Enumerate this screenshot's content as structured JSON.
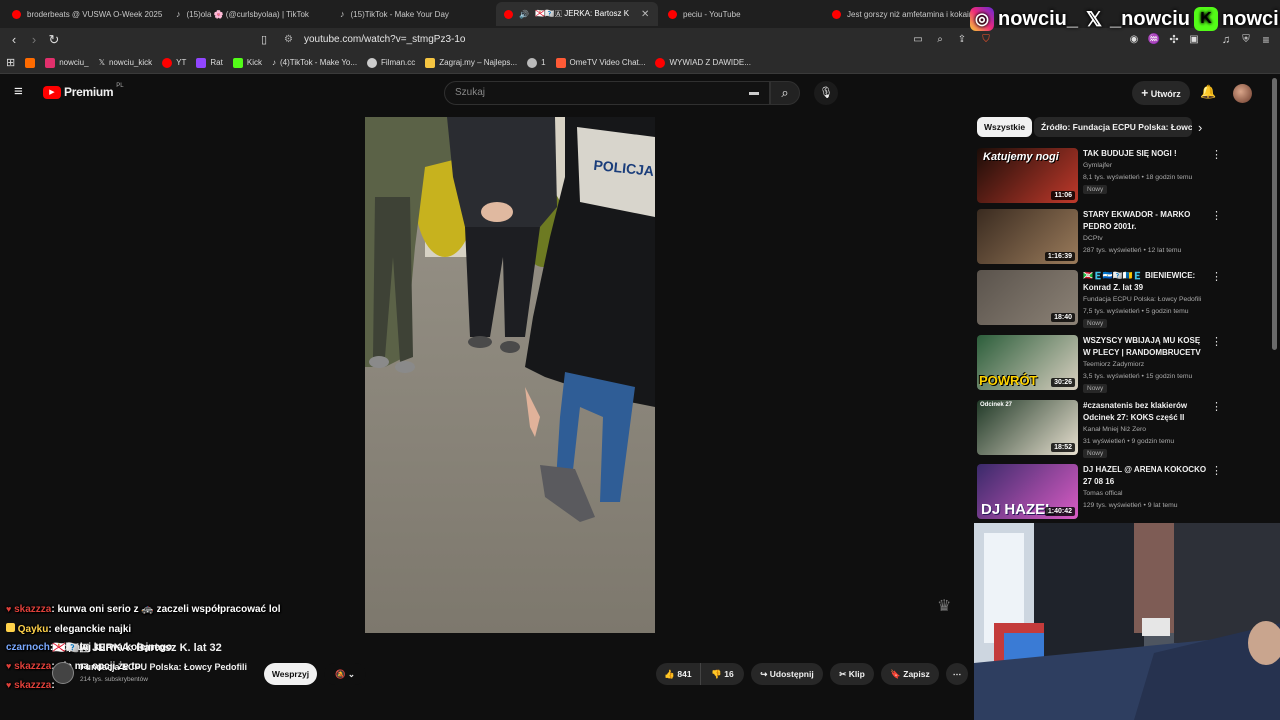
{
  "tabs": [
    {
      "label": "broderbeats @ VUSWA O-Week 2025",
      "icon": "youtube-icon",
      "color": "#ff0000"
    },
    {
      "label": "(15)ola 🌸 (@curlsbyolaa) | TikTok",
      "icon": "tiktok-icon",
      "color": "#ffffff"
    },
    {
      "label": "(15)TikTok - Make Your Day",
      "icon": "tiktok-icon",
      "color": "#ffffff"
    },
    {
      "label": "🇯🇪🇷🇰🇦 JERKA: Bartosz K",
      "icon": "youtube-icon",
      "color": "#ff0000",
      "active": true
    },
    {
      "label": "peciu - YouTube",
      "icon": "youtube-icon",
      "color": "#ff0000"
    },
    {
      "label": "Jest gorszy niż amfetamina i kokaina",
      "icon": "youtube-icon",
      "color": "#ff0000"
    }
  ],
  "socials": {
    "instagram": "nowciu_",
    "x": "_nowciu",
    "kick": "nowciu"
  },
  "address": {
    "url": "youtube.com/watch?v=_stmgPz3-1o"
  },
  "bookmarks": [
    {
      "label": "",
      "color": "#ff6b00"
    },
    {
      "label": "nowciu_",
      "color": "#e1306c"
    },
    {
      "label": "nowciu_kick",
      "color": "#ffffff"
    },
    {
      "label": "YT",
      "color": "#ff0000"
    },
    {
      "label": "Rat",
      "color": "#9146ff"
    },
    {
      "label": "Kick",
      "color": "#53fc18"
    },
    {
      "label": "(4)TikTok - Make Yo...",
      "color": "#ffffff"
    },
    {
      "label": "Filman.cc",
      "color": "#cccccc"
    },
    {
      "label": "Zagraj.my – Najleps...",
      "color": "#f5c542"
    },
    {
      "label": "1",
      "color": "#bbbbbb"
    },
    {
      "label": "OmeTV Video Chat...",
      "color": "#ff5a36"
    },
    {
      "label": "WYWIAD Z DAWIDE...",
      "color": "#ff0000"
    }
  ],
  "youtube": {
    "logo": "Premium",
    "logo_sup": "PL",
    "search_placeholder": "Szukaj",
    "create": "Utwórz"
  },
  "video": {
    "vest_text": "POLICJA"
  },
  "chips": [
    {
      "label": "Wszystkie",
      "active": true
    },
    {
      "label": "Źródło: Fundacja ECPU Polska: Łowcy Pedofili",
      "active": false
    }
  ],
  "recommendations": [
    {
      "title": "TAK BUDUJE SIĘ NOGI !",
      "channel": "Gymlajfer",
      "meta": "8,1 tys. wyświetleń • 18 godzin temu",
      "new": "Nowy",
      "duration": "11:06",
      "thumb_text": "Katujemy nogi",
      "colors": [
        "#1b0d08",
        "#c0392b"
      ]
    },
    {
      "title": "STARY EKWADOR - MARKO PEDRO 2001r.",
      "channel": "DCPtv",
      "meta": "287 tys. wyświetleń • 12 lat temu",
      "new": "",
      "duration": "1:16:39",
      "thumb_text": "",
      "colors": [
        "#3a2b20",
        "#9a7b5b"
      ]
    },
    {
      "title": "🇧🇮🇪🇳🇮🇪🇼🇮🇨🇪 BIENIEWICE: Konrad Z. lat 39",
      "channel": "Fundacja ECPU Polska: Łowcy Pedofili",
      "meta": "7,5 tys. wyświetleń • 5 godzin temu",
      "new": "Nowy",
      "duration": "18:40",
      "thumb_text": "",
      "colors": [
        "#5a534c",
        "#8c8276"
      ]
    },
    {
      "title": "WSZYSCY WBIJAJĄ MU KOSĘ W PLECY | RANDOMBRUCETV",
      "channel": "Teemiorz Zadymiorz",
      "meta": "3,5 tys. wyświetleń • 15 godzin temu",
      "new": "Nowy",
      "duration": "30:26",
      "thumb_text": "POWRÓT",
      "colors": [
        "#2c5e3b",
        "#d8cfc0"
      ]
    },
    {
      "title": "#czasnatenis bez klakierów Odcinek 27: KOKS część II",
      "channel": "Kanał Mniej Niż Zero",
      "meta": "31 wyświetleń • 9 godzin temu",
      "new": "Nowy",
      "duration": "18:52",
      "thumb_text": "Odcinek 27",
      "colors": [
        "#213a28",
        "#e8e0d0"
      ]
    },
    {
      "title": "DJ HAZEL @ ARENA KOKOCKO 27 08 16",
      "channel": "Tomas offical",
      "meta": "129 tys. wyświetleń • 9 lat temu",
      "new": "",
      "duration": "1:40:42",
      "thumb_text": "DJ HAZEL",
      "colors": [
        "#3a2a6a",
        "#d95cc4"
      ]
    }
  ],
  "chat": [
    {
      "user": "skazzza",
      "message": ": kurwa oni serio z 🚓 zaczeli współpracować lol",
      "color": "#e0403a",
      "badge": "heart"
    },
    {
      "user": "Qayku",
      "message": ": eleganckie najki",
      "color": "#ffd24a",
      "badge": "square"
    },
    {
      "user": "czarnoch",
      "message": ": odpalaj kurwa kolejnego",
      "color": "#7aa9ff",
      "badge": ""
    },
    {
      "user": "skazzza",
      "message": ": nie ma opcji że to",
      "color": "#e0403a",
      "badge": "heart"
    },
    {
      "user": "skazzza",
      "message": ":",
      "color": "#e0403a",
      "badge": "heart"
    }
  ],
  "overlay_title": "🇯🇪🇷🇰🇦 JERKA: Bartosz K. lat 32",
  "channel": {
    "name": "Fundacja ECPU Polska: Łowcy Pedofili",
    "subs": "214 tys. subskrybentów",
    "support": "Wesprzyj"
  },
  "actions": {
    "likes": "841",
    "dislikes": "16",
    "share": "Udostępnij",
    "clip": "Klip",
    "save": "Zapisz"
  }
}
